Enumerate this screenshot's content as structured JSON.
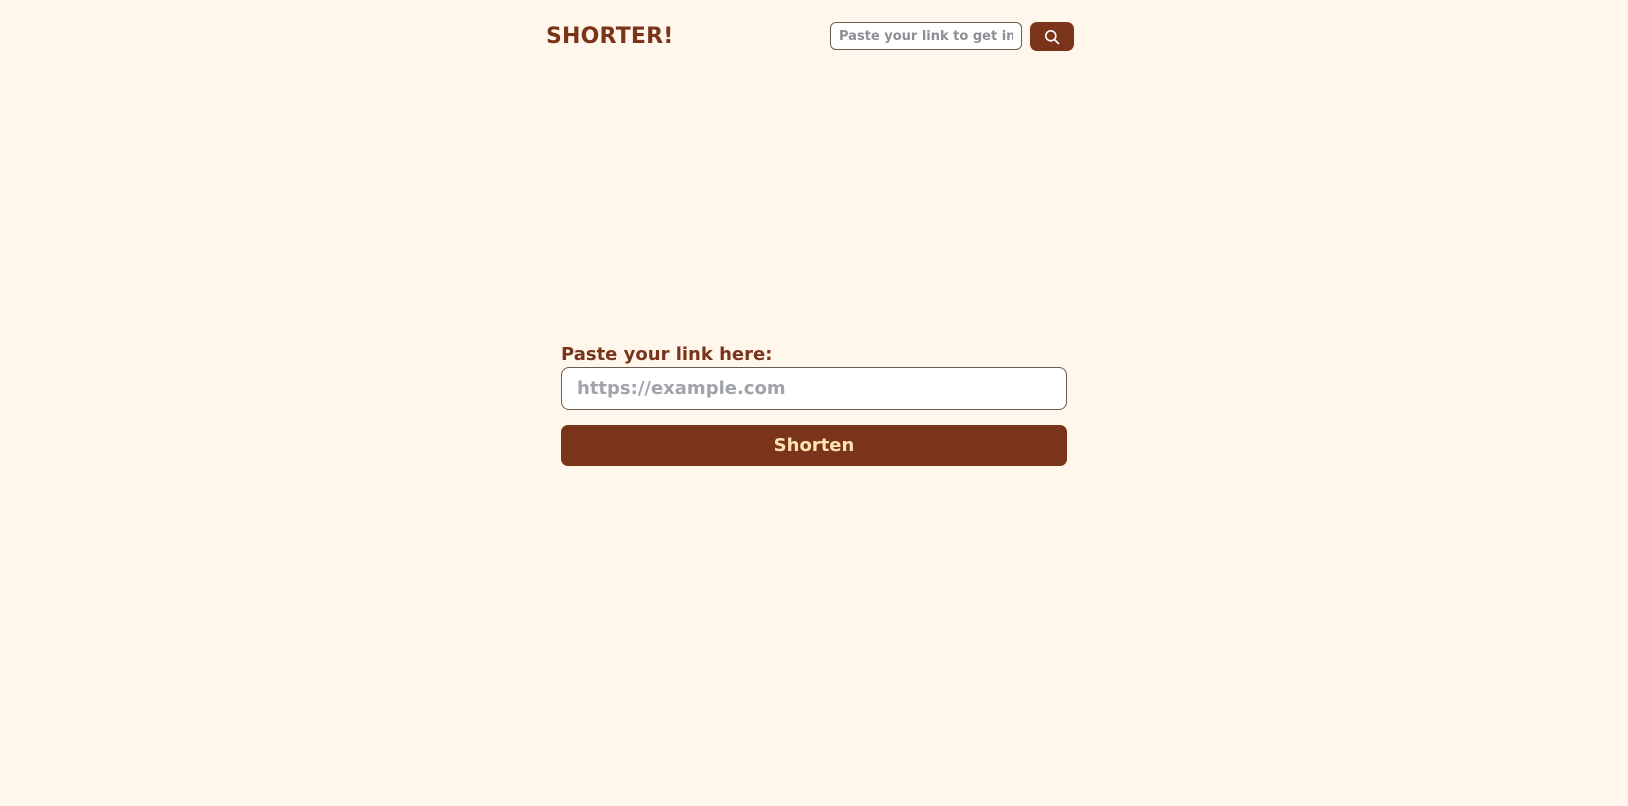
{
  "header": {
    "logo": "SHORTER!",
    "search_placeholder": "Paste your link to get info!",
    "search_icon": "search-icon"
  },
  "main": {
    "label": "Paste your link here:",
    "input_placeholder": "https://example.com",
    "button_label": "Shorten"
  },
  "colors": {
    "background": "#fff7ec",
    "brand": "#7a3419",
    "button_text": "#ffe3b0"
  }
}
